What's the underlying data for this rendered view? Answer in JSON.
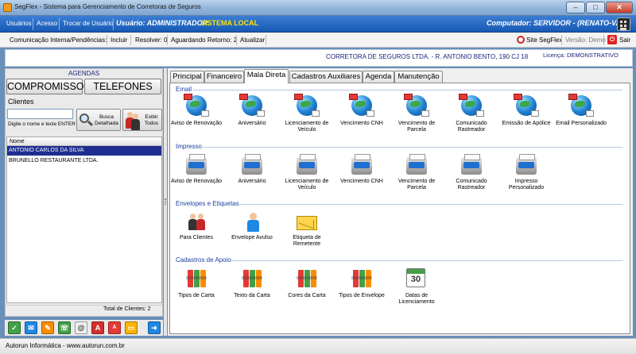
{
  "window": {
    "title": "SegFlex - Sistema para Gerenciamento de Corretoras de Seguros"
  },
  "menu": {
    "items": [
      "Usuários",
      "Acesso",
      "Trocar de Usuário"
    ],
    "user": "Usuário: ADMINISTRADOR",
    "mode": "SISTEMA LOCAL",
    "computer": "Computador: SERVIDOR - (RENATO-VAIO)"
  },
  "toolbar": {
    "label": "Comunicação Interna/Pendências:",
    "incluir": "Incluir",
    "resolver": "Resolver: 0",
    "aguardando": "Aguardando Retorno: 2",
    "atualizar": "Atualizar",
    "site": "Site SegFlex",
    "versao": "Versão: Demo",
    "sair": "Sair"
  },
  "header": {
    "company": "CORRETORA DE SEGUROS LTDA. - R. ANTONIO BENTO, 190 CJ 18",
    "licenca": "Licença: DEMONSTRATIVO"
  },
  "left": {
    "agendas": "AGENDAS",
    "compromissos": "COMPROMISSOS",
    "telefones": "TELEFONES",
    "clientes_label": "Clientes",
    "search_value": "",
    "search_hint": "Digite o nome e tecle ENTER",
    "busca": [
      "Busca",
      "Detalhada"
    ],
    "exibir": [
      "Exibir",
      "Todos"
    ],
    "column": "Nome",
    "rows": [
      "ANTONIO CARLOS DA SILVA",
      "BRUNELLO RESTAURANTE LTDA."
    ],
    "total": "Total de Clientes: 2"
  },
  "status": {
    "text": "Autorun Informática - www.autorun.com.br"
  },
  "tabs": [
    "Principal",
    "Financeiro",
    "Mala Direta",
    "Cadastros Auxiliares",
    "Agenda",
    "Manutenção"
  ],
  "sections": {
    "email": {
      "title": "Email",
      "items": [
        [
          "Aviso de Renovação"
        ],
        [
          "Aniversário"
        ],
        [
          "Licenciamento de",
          "Veículo"
        ],
        [
          "Vencimento CNH"
        ],
        [
          "Vencimento de",
          "Parcela"
        ],
        [
          "Comunicado",
          "Rastreador"
        ],
        [
          "Emissão de Apólice"
        ],
        [
          "Email Personalizado"
        ]
      ]
    },
    "impresso": {
      "title": "Impresso",
      "items": [
        [
          "Aviso de Renovação"
        ],
        [
          "Aniversário"
        ],
        [
          "Licenciamento de",
          "Veículo"
        ],
        [
          "Vencimento CNH"
        ],
        [
          "Vencimento de",
          "Parcela"
        ],
        [
          "Comunicado",
          "Rastreador"
        ],
        [
          "Impresso",
          "Personalizado"
        ]
      ]
    },
    "envelopes": {
      "title": "Envelopes e Etiquetas",
      "items": [
        [
          "Para Clientes"
        ],
        [
          "Envelope Avulso"
        ],
        [
          "Etiqueta de",
          "Remetente"
        ]
      ]
    },
    "cadastros": {
      "title": "Cadastros de Apoio",
      "items": [
        [
          "Tipos de Carta"
        ],
        [
          "Texto da Carta"
        ],
        [
          "Cores da Carta"
        ],
        [
          "Tipos de Envelope"
        ],
        [
          "Datas de",
          "Licenciamento"
        ]
      ]
    }
  },
  "calendar_day": "30",
  "icons": {
    "email": "globe-mail-icon",
    "impresso": "printer-icon",
    "para_clientes": "people-icon",
    "envelope_avulso": "person-icon",
    "etiqueta": "envelope-icon",
    "cadastros": "binders-icon",
    "datas": "calendar-icon"
  }
}
